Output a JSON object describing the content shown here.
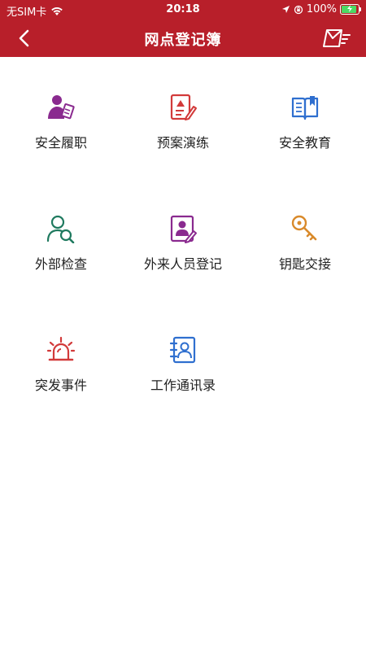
{
  "status_bar": {
    "carrier": "无SIM卡",
    "time": "20:18",
    "battery": "100%"
  },
  "header": {
    "title": "网点登记簿"
  },
  "grid_items": [
    {
      "label": "安全履职",
      "icon": "person-edit-icon",
      "color": "#8a2a8f"
    },
    {
      "label": "预案演练",
      "icon": "document-warning-icon",
      "color": "#d23a3a"
    },
    {
      "label": "安全教育",
      "icon": "book-icon",
      "color": "#2f6fcf"
    },
    {
      "label": "外部检查",
      "icon": "person-search-icon",
      "color": "#1f7a5f"
    },
    {
      "label": "外来人员登记",
      "icon": "id-card-edit-icon",
      "color": "#8a2a8f"
    },
    {
      "label": "钥匙交接",
      "icon": "key-icon",
      "color": "#d98a2b"
    },
    {
      "label": "突发事件",
      "icon": "alarm-light-icon",
      "color": "#d23a3a"
    },
    {
      "label": "工作通讯录",
      "icon": "contacts-book-icon",
      "color": "#2f6fcf"
    }
  ]
}
